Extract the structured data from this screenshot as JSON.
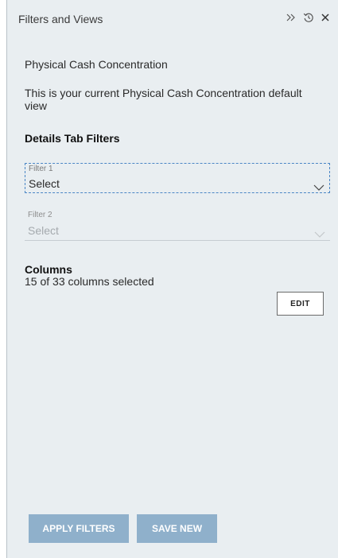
{
  "header": {
    "title": "Filters and Views",
    "icons": {
      "expand": "double-chevron-right-icon",
      "history": "history-icon",
      "close": "close-icon"
    }
  },
  "view": {
    "name": "Physical Cash Concentration",
    "description": "This is your current Physical Cash Concentration default view"
  },
  "filters": {
    "section_title": "Details Tab Filters",
    "items": [
      {
        "label": "Filter 1",
        "value": "Select",
        "enabled": true,
        "focused": true
      },
      {
        "label": "Filter 2",
        "value": "Select",
        "enabled": false,
        "focused": false
      }
    ]
  },
  "columns": {
    "title": "Columns",
    "summary": "15 of 33 columns selected",
    "edit_label": "EDIT"
  },
  "footer": {
    "apply_label": "APPLY FILTERS",
    "save_label": "SAVE NEW"
  },
  "colors": {
    "panel_bg": "#e9eef1",
    "primary_button_disabled": "#8fb0cb",
    "focus_outline": "#4a86c5"
  }
}
